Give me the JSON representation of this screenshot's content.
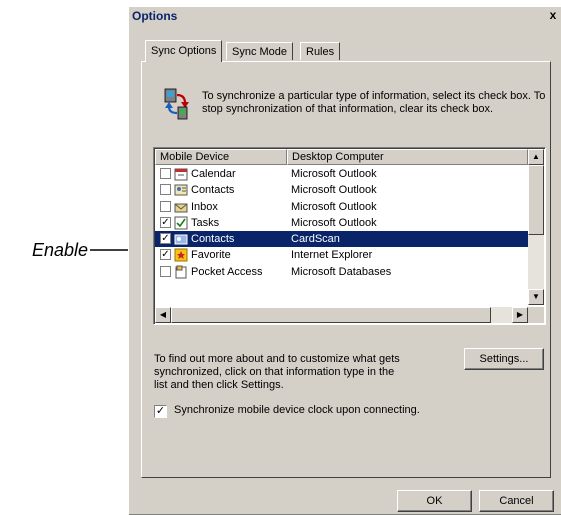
{
  "annotation": {
    "text": "Enable"
  },
  "dialog": {
    "title": "Options",
    "close_glyph": "x",
    "tabs": [
      {
        "label": "Sync Options",
        "active": true
      },
      {
        "label": "Sync Mode",
        "active": false
      },
      {
        "label": "Rules",
        "active": false
      }
    ],
    "description": "To synchronize a particular type of information, select its check box. To stop synchronization of that information, clear its check box.",
    "list": {
      "columns": [
        "Mobile Device",
        "Desktop Computer"
      ],
      "rows": [
        {
          "checked": false,
          "device": "Calendar",
          "desktop": "Microsoft Outlook",
          "icon": "calendar-icon",
          "selected": false
        },
        {
          "checked": false,
          "device": "Contacts",
          "desktop": "Microsoft Outlook",
          "icon": "contacts-icon",
          "selected": false
        },
        {
          "checked": false,
          "device": "Inbox",
          "desktop": "Microsoft Outlook",
          "icon": "inbox-icon",
          "selected": false
        },
        {
          "checked": true,
          "device": "Tasks",
          "desktop": "Microsoft Outlook",
          "icon": "tasks-icon",
          "selected": false
        },
        {
          "checked": true,
          "device": "Contacts",
          "desktop": "CardScan",
          "icon": "cardscan-icon",
          "selected": true
        },
        {
          "checked": true,
          "device": "Favorite",
          "desktop": "Internet Explorer",
          "icon": "favorite-icon",
          "selected": false
        },
        {
          "checked": false,
          "device": "Pocket Access",
          "desktop": "Microsoft Databases",
          "icon": "pocket-access-icon",
          "selected": false
        }
      ]
    },
    "info_text": "To find out more about and to customize what gets synchronized, click on that information type in the list and then click Settings.",
    "settings_label": "Settings...",
    "clock_label": "Synchronize mobile device clock upon connecting.",
    "clock_checked": true,
    "ok_label": "OK",
    "cancel_label": "Cancel"
  },
  "colors": {
    "dialog_face": "#d4d0c8",
    "selection": "#0a246a",
    "title_text": "#0a246a"
  }
}
